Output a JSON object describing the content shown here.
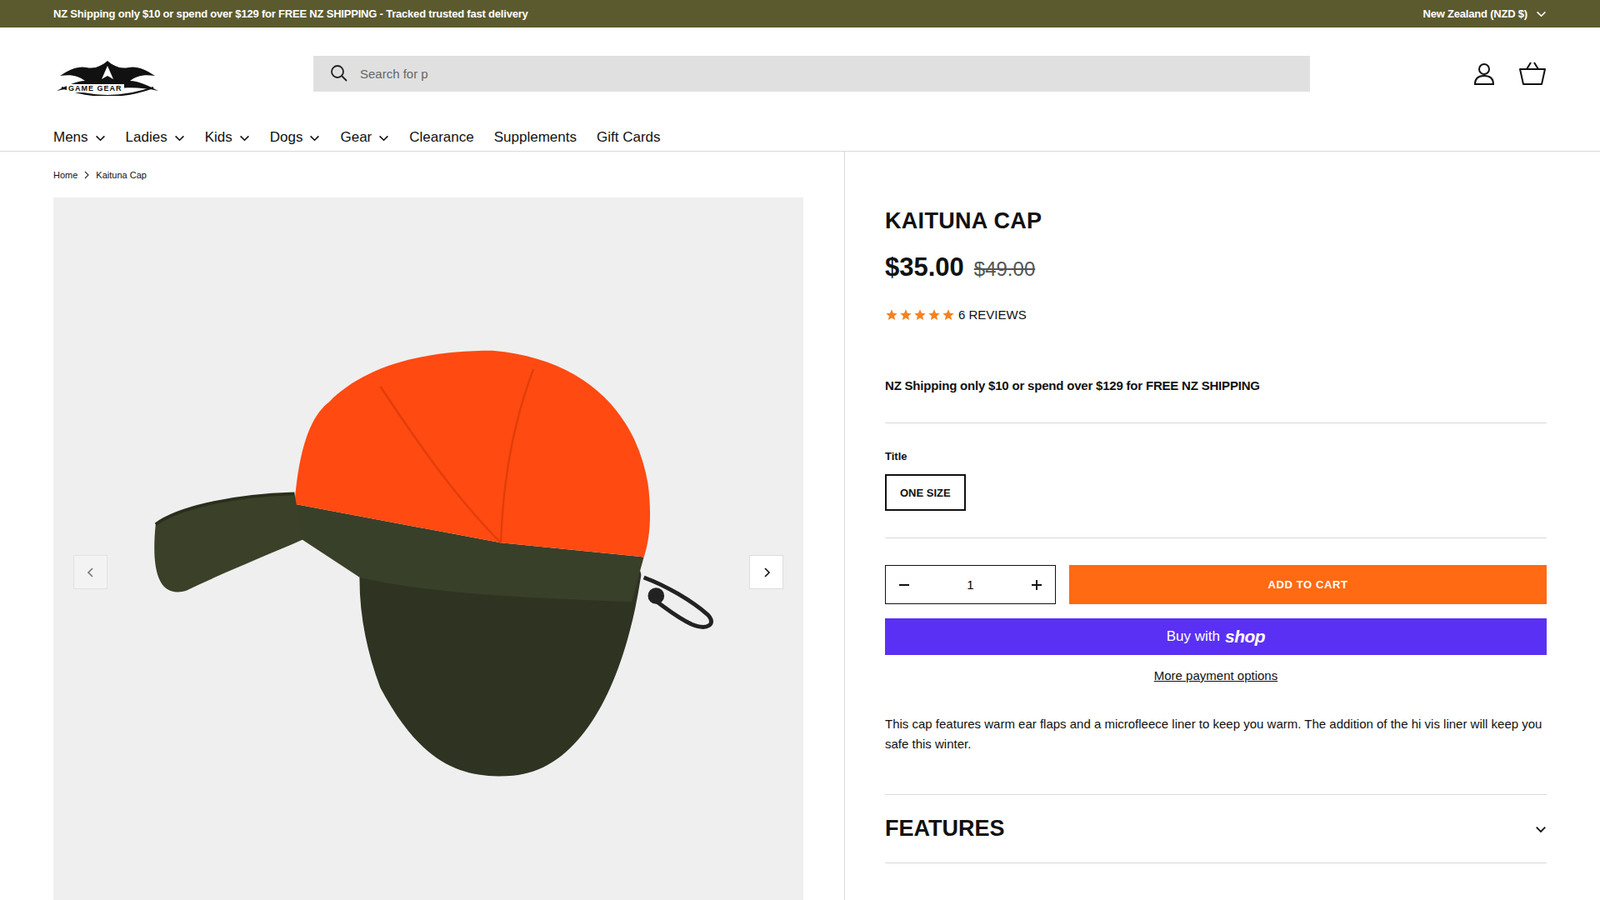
{
  "announcement": {
    "text": "NZ Shipping only $10 or spend over $129 for FREE NZ SHIPPING - Tracked trusted fast delivery",
    "region": "New Zealand (NZD $)"
  },
  "logo": {
    "text": "GAME GEAR"
  },
  "search": {
    "placeholder": "Search for p"
  },
  "nav": [
    {
      "label": "Mens",
      "dropdown": true
    },
    {
      "label": "Ladies",
      "dropdown": true
    },
    {
      "label": "Kids",
      "dropdown": true
    },
    {
      "label": "Dogs",
      "dropdown": true
    },
    {
      "label": "Gear",
      "dropdown": true
    },
    {
      "label": "Clearance",
      "dropdown": false
    },
    {
      "label": "Supplements",
      "dropdown": false
    },
    {
      "label": "Gift Cards",
      "dropdown": false
    }
  ],
  "breadcrumb": [
    "Home",
    "Kaituna Cap"
  ],
  "product": {
    "title": "KAITUNA CAP",
    "price": "$35.00",
    "compare_price": "$49.00",
    "stars": 5,
    "reviews": "6 REVIEWS",
    "shipping_note": "NZ Shipping only $10 or spend over $129 for FREE NZ SHIPPING",
    "option_label": "Title",
    "options": [
      {
        "label": "ONE SIZE",
        "selected": true
      }
    ],
    "quantity": "1",
    "add_to_cart": "ADD TO CART",
    "buy_with": "Buy with",
    "shop_logo": "shop",
    "more_payment": "More payment options",
    "description": "This cap features warm ear flaps and a microfleece liner to keep you warm. The addition of the hi vis liner will keep you safe this winter.",
    "sections": [
      {
        "title": "FEATURES",
        "expanded": false
      }
    ]
  }
}
